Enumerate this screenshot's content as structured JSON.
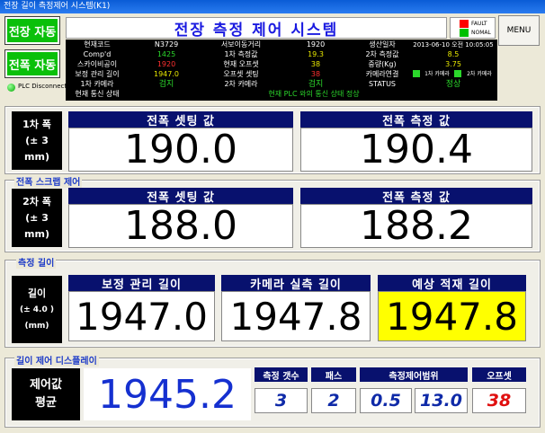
{
  "window": {
    "title": "전장 길이 측정제어 시스템(K1)"
  },
  "buttons": {
    "length_auto": "전장 자동",
    "width_auto": "전폭 자동",
    "menu": "MENU"
  },
  "plc": {
    "status": "PLC Disconnect"
  },
  "header": {
    "title": "전장 측정 제어 시스템"
  },
  "lamps": {
    "fault": "FAULT",
    "normal": "NOMAL"
  },
  "info": {
    "product_code_label": "현재코드",
    "product_code": "N3729",
    "servo_move_label": "서보이동거리",
    "servo_move": "1920",
    "prod_date_label": "생산일자",
    "prod_date": "2013-06-10 오전 10:05:05",
    "compd_label": "Comp'd",
    "compd": "1425",
    "first_measure_label": "1차 측정값",
    "first_measure": "19.3",
    "second_measure_label": "2차 측정값",
    "second_measure": "8.5",
    "scr_label": "스카이비공이",
    "scr": "1920",
    "current_offset_label": "현재 오프셋",
    "current_offset": "38",
    "weight_label": "중량(Kg)",
    "weight": "3.75",
    "corr_length_label": "보정 관리 길이",
    "corr_length": "1947.0",
    "offset_set_label": "오프셋 셋팅",
    "offset_set": "38",
    "camera_conn_label": "카메라연결",
    "cam1": "1차 카메라",
    "cam2": "2차 카메라",
    "cam1_label": "1차 카메라",
    "cam1_status": "검지",
    "cam2_label": "2차 카메라",
    "cam2_status": "검지",
    "status_label": "STATUS",
    "status_value": "정상",
    "comm_label": "현재 통신 상태",
    "comm_value": "현재 PLC 와의 통신 상태 정상"
  },
  "width1": {
    "side_line1": "1차 폭",
    "side_line2": "(± 3 mm)",
    "set_label": "전폭 셋팅 값",
    "set_value": "190.0",
    "meas_label": "전폭 측정 값",
    "meas_value": "190.4"
  },
  "width2": {
    "section": "전폭 스크랩 제어",
    "side_line1": "2차 폭",
    "side_line2": "(± 3 mm)",
    "set_label": "전폭 셋팅 값",
    "set_value": "188.0",
    "meas_label": "전폭 측정 값",
    "meas_value": "188.2"
  },
  "length": {
    "section": "측정 길이",
    "side_line1": "길이",
    "side_line2": "(± 4.0 )",
    "side_line3": "(mm)",
    "corr_label": "보정 관리 길이",
    "corr_value": "1947.0",
    "camera_label": "카메라 실측 길이",
    "camera_value": "1947.8",
    "expected_label": "예상 적재 길이",
    "expected_value": "1947.8",
    "expected_color": "#ffff00"
  },
  "control": {
    "section": "길이 제어 디스플레이",
    "side_line1": "제어값",
    "side_line2": "평균",
    "avg_value": "1945.2",
    "count_label": "측정 갯수",
    "count_value": "3",
    "pass_label": "패스",
    "pass_value": "2",
    "range_label": "측정제어범위",
    "range_min": "0.5",
    "range_max": "13.0",
    "offset_label": "오프셋",
    "offset_value": "38"
  },
  "colors": {
    "accent_blue": "#1e3cc8",
    "header_navy": "#08116e",
    "green_button": "#0ac00a",
    "fault_red": "#ff0000",
    "normal_green": "#00c000"
  }
}
